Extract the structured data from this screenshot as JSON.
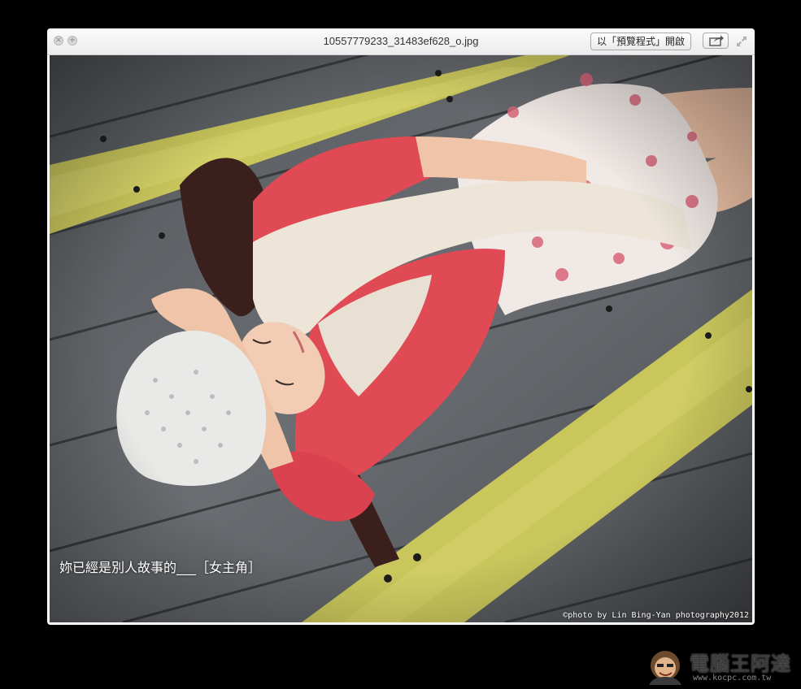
{
  "window": {
    "title": "10557779233_31483ef628_o.jpg",
    "open_with_label": "以「預覽程式」開啟",
    "close_glyph": "×",
    "zoom_glyph": "+"
  },
  "photo": {
    "caption": "妳已經是別人故事的___［女主角］",
    "credit": "©photo by Lin Bing-Yan photography2012"
  },
  "watermark": {
    "site_name": "電腦王阿達",
    "url": "www.kocpc.com.tw"
  },
  "colors": {
    "accent_yellow": "#c9c65c",
    "sweater_red": "#e04a55",
    "deck_gray": "#5b5e62"
  }
}
